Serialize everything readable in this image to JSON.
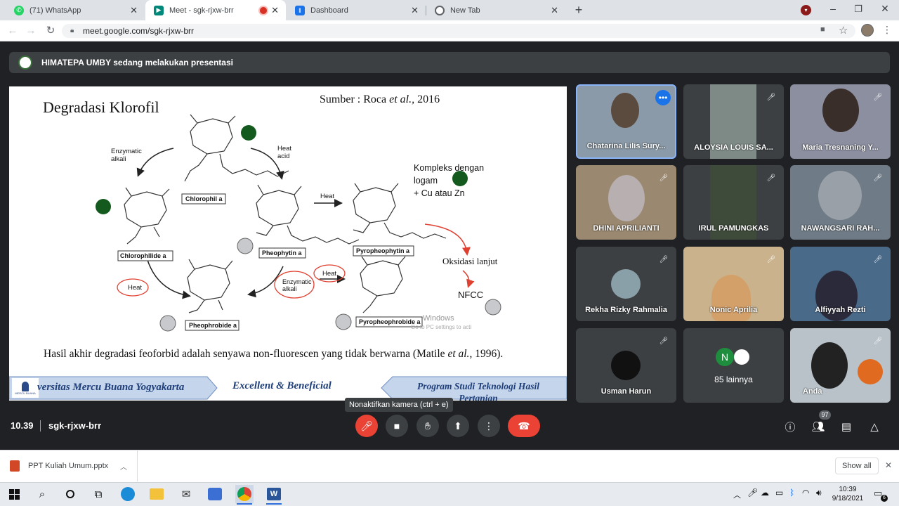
{
  "tabs": [
    {
      "title": "(71) WhatsApp",
      "close": "✕"
    },
    {
      "title": "Meet - sgk-rjxw-brr",
      "close": "✕"
    },
    {
      "title": "Dashboard",
      "close": "✕"
    },
    {
      "title": "New Tab",
      "close": "✕"
    }
  ],
  "new_tab": "+",
  "url": "meet.google.com/sgk-rjxw-brr",
  "banner": "HIMATEPA UMBY sedang melakukan presentasi",
  "slide": {
    "title": "Degradasi Klorofil",
    "source_prefix": "Sumber : Roca ",
    "source_em": "et al.,",
    "source_year": " 2016",
    "labels": {
      "enzymatic1": "Enzymatic",
      "alkali1": "alkali",
      "heat_acid1": "Heat",
      "heat_acid2": "acid",
      "chlorophil": "Chlorophil a",
      "heat_top": "Heat",
      "kompleks1": "Kompleks dengan",
      "kompleks2": "logam",
      "kompleks3": "+ Cu atau Zn",
      "pheophytin": "Pheophytin a",
      "pyropheophytin": "Pyropheophytin a",
      "chlorophllide": "Chlorophllide a",
      "heat_left": "Heat",
      "enzymatic2": "Enzymatic",
      "alkali2": "alkali",
      "heat_mid": "Heat",
      "oksidasi": "Oksidasi lanjut",
      "nfcc": "NFCC",
      "pheophrobide": "Pheophrobide a",
      "pyropheophrobide": "Pyropheophrobide a",
      "watermark1": "Windows",
      "watermark2": "Go to PC settings to acti"
    },
    "footnote_pre": "Hasil akhir degradasi feoforbid adalah senyawa non-fluorescen yang tidak berwarna (Matile ",
    "footnote_em": "et al.",
    "footnote_post": ", 1996).",
    "footer_left": "versitas Mercu Buana Yogyakarta",
    "footer_mid": "Excellent & Beneficial",
    "footer_right1": "Program Studi Teknologi Hasil",
    "footer_right2": "Pertanian",
    "logo_text": "MERCU BUANA"
  },
  "participants": [
    {
      "name": "Chatarina Lilis Sury...",
      "color": "#8a9aa8"
    },
    {
      "name": "ALOYSIA LOUIS SA...",
      "color": "#7e8a86"
    },
    {
      "name": "Maria Tresnaning Y...",
      "color": "#8c8fa0"
    },
    {
      "name": "DHINI APRILIANTI",
      "color": "#9a8870"
    },
    {
      "name": "IRUL PAMUNGKAS",
      "color": "#3e4a3a"
    },
    {
      "name": "NAWANGSARI RAH...",
      "color": "#6f7b86"
    },
    {
      "name": "Rekha Rizky Rahmalia",
      "color": "#3c4043"
    },
    {
      "name": "Nonic Aprilia",
      "color": "#c9b28c"
    },
    {
      "name": "Alfiyyah Rezti",
      "color": "#4a6a8a"
    },
    {
      "name": "Usman Harun",
      "color": "#3c4043"
    },
    {
      "name": "85 lainnya",
      "color": "#3c4043"
    },
    {
      "name": "Anda",
      "color": "#b8c2c8"
    }
  ],
  "others_initial": "N",
  "tooltip": "Nonaktifkan kamera (ctrl + e)",
  "time": "10.39",
  "meeting_code": "sgk-rjxw-brr",
  "people_count": "97",
  "download": {
    "file": "PPT Kuliah Umum.pptx",
    "show_all": "Show all"
  },
  "clock": {
    "time": "10:39",
    "date": "9/18/2021"
  },
  "notif_count": "6",
  "colors": {
    "meet_bg": "#202124",
    "end_call": "#ea4335",
    "mic_off": "#ea4335",
    "active_border": "#8ab4f8"
  }
}
